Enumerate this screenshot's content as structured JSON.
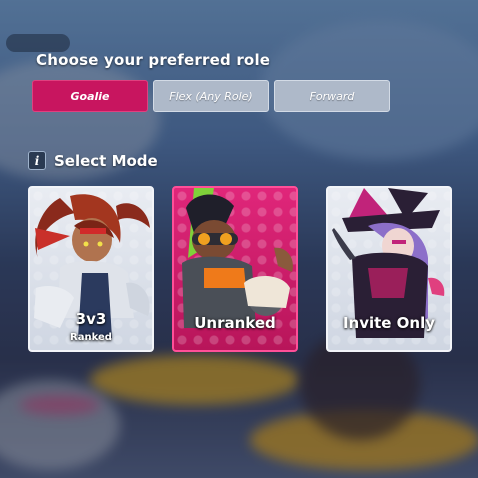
{
  "role_section": {
    "title": "Choose your preferred role",
    "options": [
      {
        "label": "Goalie",
        "selected": true
      },
      {
        "label": "Flex (Any Role)",
        "selected": false
      },
      {
        "label": "Forward",
        "selected": false
      }
    ]
  },
  "mode_section": {
    "title": "Select Mode",
    "info_icon_glyph": "i",
    "cards": [
      {
        "label": "3v3",
        "sublabel": "Ranked",
        "selected": false
      },
      {
        "label": "Unranked",
        "sublabel": "",
        "selected": true
      },
      {
        "label": "Invite Only",
        "sublabel": "",
        "selected": false
      }
    ]
  },
  "colors": {
    "accent": "#c8155f",
    "unselected_button": "#aeb9c9"
  }
}
